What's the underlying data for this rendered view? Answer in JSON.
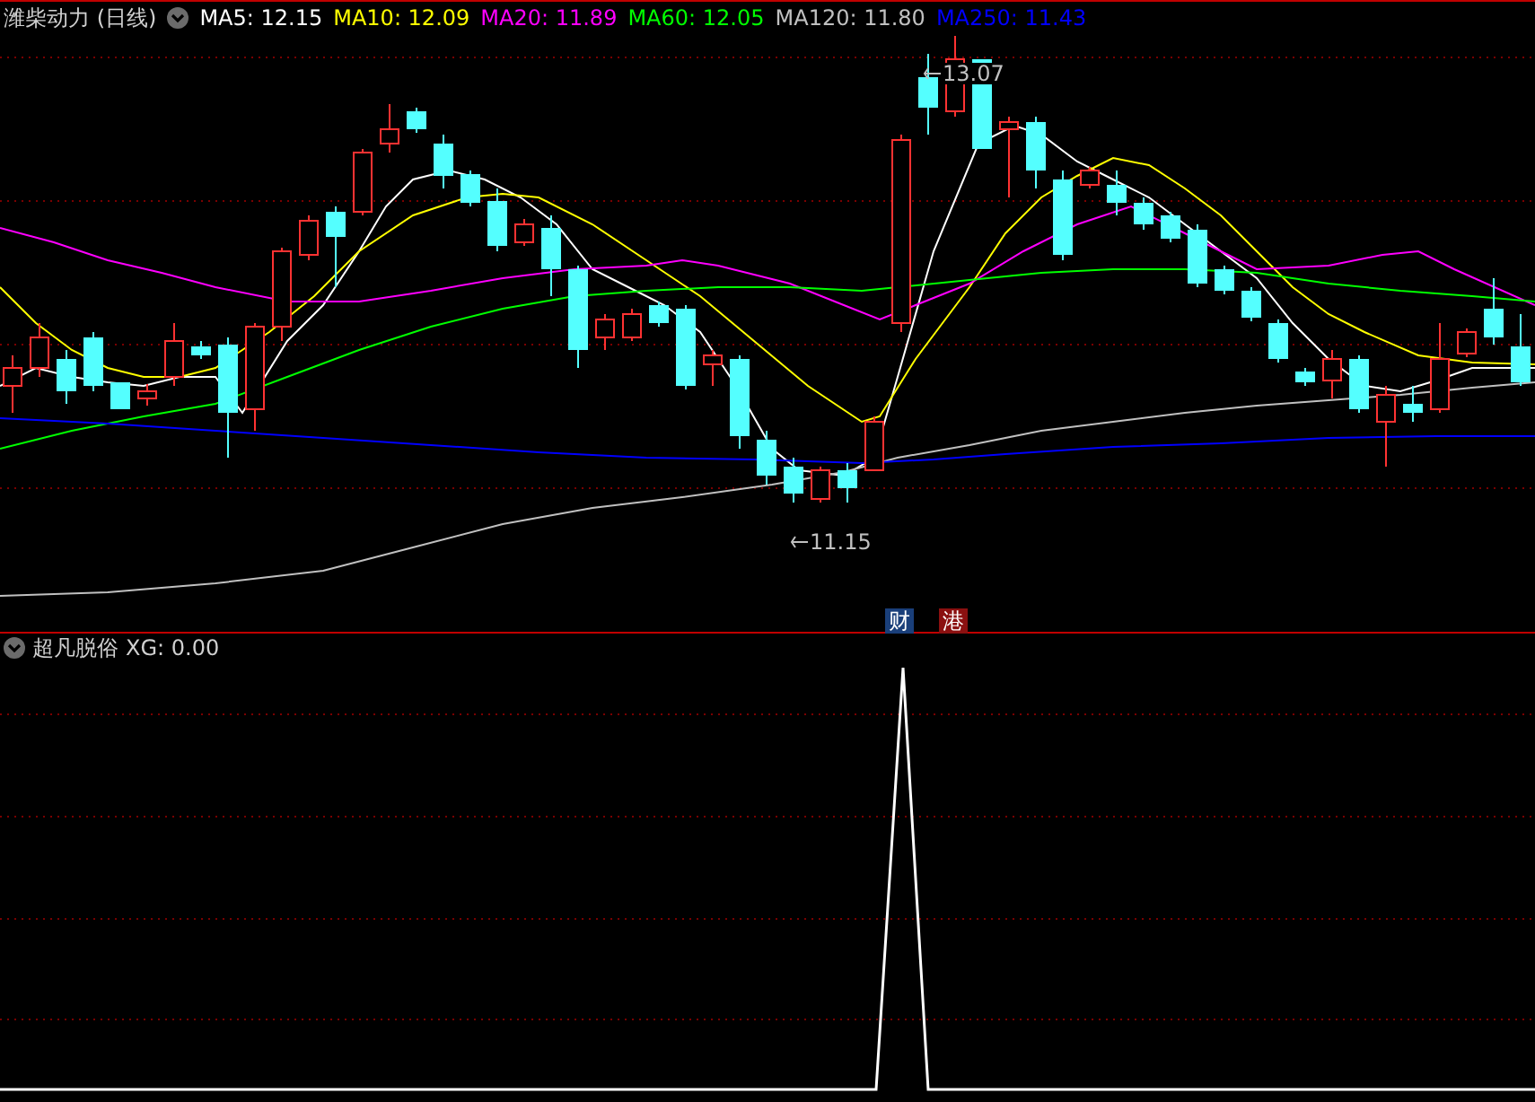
{
  "stock": {
    "title": "潍柴动力 (日线)"
  },
  "moving_averages": [
    {
      "text": "MA5: 12.15",
      "color": "#ffffff"
    },
    {
      "text": "MA10: 12.09",
      "color": "#ffff00"
    },
    {
      "text": "MA20: 11.89",
      "color": "#ff00ff"
    },
    {
      "text": "MA60: 12.05",
      "color": "#00ff00"
    },
    {
      "text": "MA120: 11.80",
      "color": "#c0c0c0"
    },
    {
      "text": "MA250: 11.43",
      "color": "#0000ff"
    }
  ],
  "price_markers": [
    {
      "kind": "high",
      "label": "13.07"
    },
    {
      "kind": "low",
      "label": "11.15"
    }
  ],
  "badges": [
    {
      "label": "财",
      "color": "#1a3f7a"
    },
    {
      "label": "港",
      "color": "#8b1010"
    }
  ],
  "indicator": {
    "name": "超凡脱俗",
    "reading": "XG: 0.00"
  }
}
